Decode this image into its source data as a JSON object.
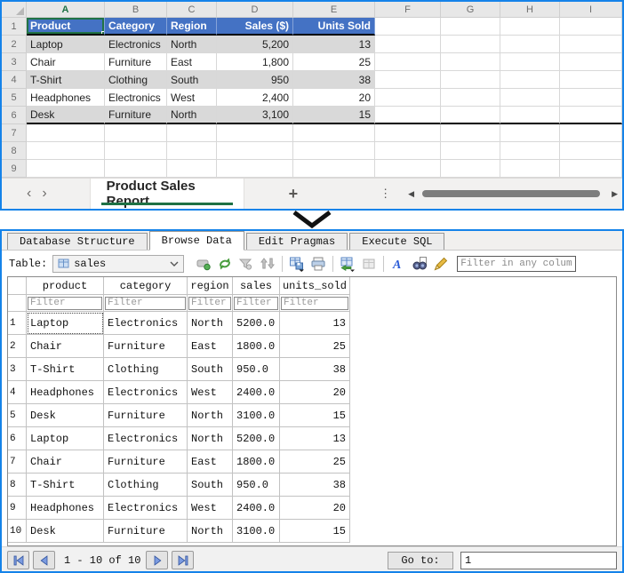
{
  "excel": {
    "col_headers": [
      "A",
      "B",
      "C",
      "D",
      "E",
      "F",
      "G",
      "H",
      "I"
    ],
    "selected_column": "A",
    "row_numbers": [
      "1",
      "2",
      "3",
      "4",
      "5",
      "6",
      "7",
      "8",
      "9"
    ],
    "table": {
      "headers": [
        "Product",
        "Category",
        "Region",
        "Sales ($)",
        "Units Sold"
      ],
      "rows": [
        [
          "Laptop",
          "Electronics",
          "North",
          "5,200",
          "13"
        ],
        [
          "Chair",
          "Furniture",
          "East",
          "1,800",
          "25"
        ],
        [
          "T-Shirt",
          "Clothing",
          "South",
          "950",
          "38"
        ],
        [
          "Headphones",
          "Electronics",
          "West",
          "2,400",
          "20"
        ],
        [
          "Desk",
          "Furniture",
          "North",
          "3,100",
          "15"
        ]
      ]
    },
    "sheet_tab_label": "Product Sales Report",
    "nav_prev": "‹",
    "nav_next": "›",
    "add_sheet_label": "+",
    "more_label": "⋮",
    "colors": {
      "header_fill": "#4472C4",
      "band_fill": "#D9D9D9",
      "selection_green": "#217346",
      "panel_border": "#1583e9"
    }
  },
  "arrow": {
    "shape": "down-chevron",
    "color": "#111111"
  },
  "db": {
    "tabs": [
      {
        "label": "Database Structure",
        "active": false
      },
      {
        "label": "Browse Data",
        "active": true
      },
      {
        "label": "Edit Pragmas",
        "active": false
      },
      {
        "label": "Execute SQL",
        "active": false
      }
    ],
    "toolbar": {
      "table_label": "Table:",
      "table_value": "sales",
      "filter_placeholder": "Filter in any column",
      "icons": [
        "table-icon",
        "new-record-icon",
        "refresh-icon",
        "clear-filter-icon",
        "sort-icon",
        "save-results-icon",
        "print-icon",
        "export-table-icon",
        "table-disabled-icon",
        "format-font-icon",
        "find-icon",
        "edit-cell-icon"
      ]
    },
    "grid": {
      "columns": [
        "product",
        "category",
        "region",
        "sales",
        "units_sold"
      ],
      "filter_placeholder": "Filter",
      "rows": [
        {
          "num": "1",
          "cells": [
            "Laptop",
            "Electronics",
            "North",
            "5200.0",
            "13"
          ]
        },
        {
          "num": "2",
          "cells": [
            "Chair",
            "Furniture",
            "East",
            "1800.0",
            "25"
          ]
        },
        {
          "num": "3",
          "cells": [
            "T-Shirt",
            "Clothing",
            "South",
            "950.0",
            "38"
          ]
        },
        {
          "num": "4",
          "cells": [
            "Headphones",
            "Electronics",
            "West",
            "2400.0",
            "20"
          ]
        },
        {
          "num": "5",
          "cells": [
            "Desk",
            "Furniture",
            "North",
            "3100.0",
            "15"
          ]
        },
        {
          "num": "6",
          "cells": [
            "Laptop",
            "Electronics",
            "North",
            "5200.0",
            "13"
          ]
        },
        {
          "num": "7",
          "cells": [
            "Chair",
            "Furniture",
            "East",
            "1800.0",
            "25"
          ]
        },
        {
          "num": "8",
          "cells": [
            "T-Shirt",
            "Clothing",
            "South",
            "950.0",
            "38"
          ]
        },
        {
          "num": "9",
          "cells": [
            "Headphones",
            "Electronics",
            "West",
            "2400.0",
            "20"
          ]
        },
        {
          "num": "10",
          "cells": [
            "Desk",
            "Furniture",
            "North",
            "3100.0",
            "15"
          ]
        }
      ]
    },
    "pagination": {
      "range_label": "1 - 10 of 10",
      "goto_label": "Go to:",
      "goto_value": "1"
    }
  }
}
